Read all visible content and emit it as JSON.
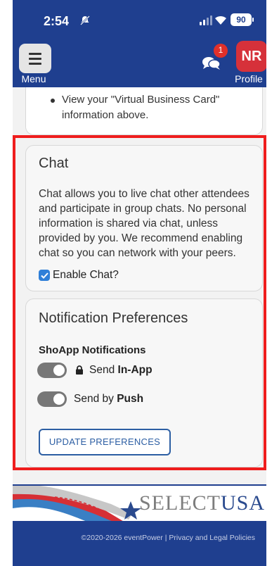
{
  "status": {
    "time": "2:54",
    "battery": "90"
  },
  "header": {
    "menu_label": "Menu",
    "profile_initials": "NR",
    "profile_label": "Profile",
    "chat_badge": "1"
  },
  "prev_card": {
    "line1": "View your \"Virtual Business Card\"",
    "line2": "information above."
  },
  "chat_card": {
    "title": "Chat",
    "body": "Chat allows you to live chat other attendees and participate in group chats. No personal information is shared via chat, unless provided by you. We recommend enabling chat so you can network with your peers.",
    "checkbox_label": "Enable Chat?"
  },
  "notif_card": {
    "title": "Notification Preferences",
    "subtitle": "ShoApp Notifications",
    "toggle1_prefix": "Send ",
    "toggle1_bold": "In-App",
    "toggle2_prefix": "Send by ",
    "toggle2_bold": "Push",
    "update_button": "UPDATE PREFERENCES"
  },
  "footer": {
    "logo_select": "SELECT",
    "logo_usa": "USA",
    "copyright": "©2020-2026 eventPower | Privacy and Legal Policies"
  },
  "colors": {
    "header_bg": "#1f3f8f",
    "profile": "#d6313a",
    "highlight": "#ef1d1d",
    "button_border": "#2c5ea3",
    "checkbox": "#2f7fd8"
  }
}
